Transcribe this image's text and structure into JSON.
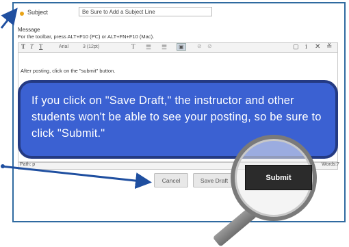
{
  "form": {
    "subject_label": "Subject",
    "subject_value": "Be Sure to Add a Subject Line",
    "message_label": "Message",
    "toolbar_hint": "For the toolbar, press ALT+F10 (PC) or ALT+FN+F10 (Mac).",
    "toolbar": {
      "bold": "T",
      "italic": "T",
      "underline": "T",
      "font_family": "Arial",
      "font_size": "3 (12pt)",
      "text_color": "T",
      "list_unordered": "☰",
      "list_ordered": "☰",
      "highlight": "▣"
    },
    "editor_text": "After posting, click on the \"submit\" button.",
    "path_label": "Path: p",
    "word_count": "Words:7"
  },
  "callout": {
    "text": "If you click on \"Save Draft,\" the instructor and other students won't be able to see your posting, so be sure to click \"Submit.\""
  },
  "buttons": {
    "cancel": "Cancel",
    "save_draft": "Save Draft",
    "submit": "Submit"
  },
  "colors": {
    "frame": "#2f6aa0",
    "callout_fill": "#3b61d2",
    "callout_border": "#243a82",
    "arrow": "#1f4fa0",
    "required_dot": "#e8a317",
    "submit_bg": "#2b2b2b"
  }
}
